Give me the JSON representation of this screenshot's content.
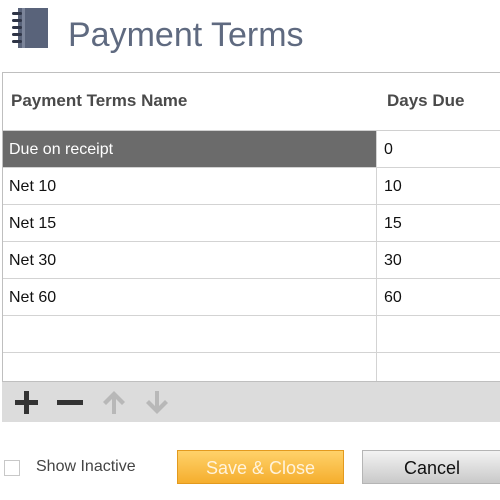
{
  "header": {
    "title": "Payment Terms",
    "icon": "notebook-icon"
  },
  "table": {
    "columns": [
      "Payment Terms Name",
      "Days Due"
    ],
    "rows": [
      {
        "name": "Due on receipt",
        "days": "0",
        "selected": true
      },
      {
        "name": "Net 10",
        "days": "10"
      },
      {
        "name": "Net 15",
        "days": "15"
      },
      {
        "name": "Net 30",
        "days": "30"
      },
      {
        "name": "Net 60",
        "days": "60"
      },
      {
        "name": "",
        "days": ""
      },
      {
        "name": "",
        "days": ""
      }
    ]
  },
  "toolbar": {
    "buttons": [
      "add-icon",
      "remove-icon",
      "move-up-icon",
      "move-down-icon"
    ]
  },
  "footer": {
    "show_inactive_label": "Show Inactive",
    "show_inactive_checked": false,
    "save_label": "Save & Close",
    "cancel_label": "Cancel"
  },
  "colors": {
    "title": "#5f6a80",
    "selected_row": "#6b6b6b",
    "save_button": "#f5ae2e",
    "toolbar": "#dcdcdc"
  }
}
